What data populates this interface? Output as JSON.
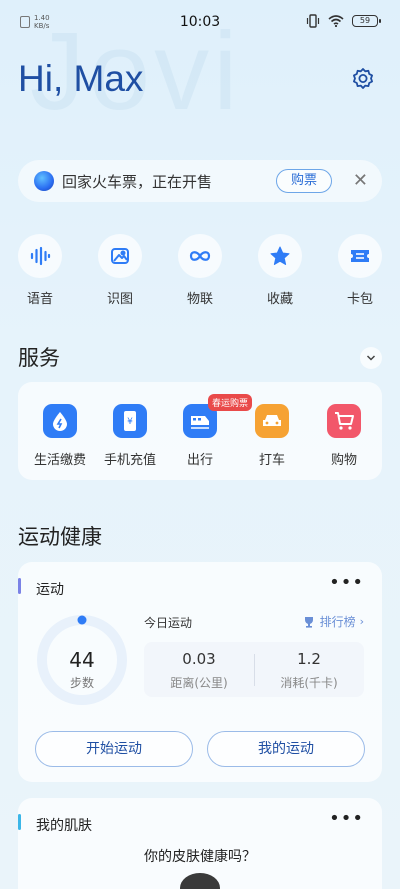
{
  "status_bar": {
    "net_speed_value": "1.40",
    "net_speed_unit": "KB/s",
    "time": "10:03",
    "battery": "59"
  },
  "header": {
    "watermark": "Jovi",
    "greeting": "Hi, Max"
  },
  "banner": {
    "text": "回家火车票，正在开售",
    "button": "购票"
  },
  "quick_actions": [
    {
      "label": "语音",
      "icon": "voice-wave-icon"
    },
    {
      "label": "识图",
      "icon": "image-recognition-icon"
    },
    {
      "label": "物联",
      "icon": "infinity-iot-icon"
    },
    {
      "label": "收藏",
      "icon": "star-icon"
    },
    {
      "label": "卡包",
      "icon": "ticket-icon"
    }
  ],
  "services": {
    "title": "服务",
    "items": [
      {
        "label": "生活缴费",
        "icon": "water-drop-icon",
        "color": "#2f7cf6"
      },
      {
        "label": "手机充值",
        "icon": "phone-yuan-icon",
        "color": "#2f7cf6"
      },
      {
        "label": "出行",
        "icon": "train-icon",
        "color": "#2f7cf6",
        "badge": "春运购票"
      },
      {
        "label": "打车",
        "icon": "car-icon",
        "color": "#f6a233"
      },
      {
        "label": "购物",
        "icon": "cart-icon",
        "color": "#f2576a"
      }
    ]
  },
  "health": {
    "title": "运动健康",
    "sport_card": {
      "title": "运动",
      "steps": "44",
      "steps_label": "步数",
      "today_label": "今日运动",
      "rank_label": "排行榜",
      "distance_value": "0.03",
      "distance_label": "距离(公里)",
      "calories_value": "1.2",
      "calories_label": "消耗(千卡)",
      "start_button": "开始运动",
      "my_button": "我的运动",
      "accent": "#7a82e6"
    },
    "skin_card": {
      "title": "我的肌肤",
      "question": "你的皮肤健康吗？",
      "accent": "#3bb6e8"
    }
  }
}
